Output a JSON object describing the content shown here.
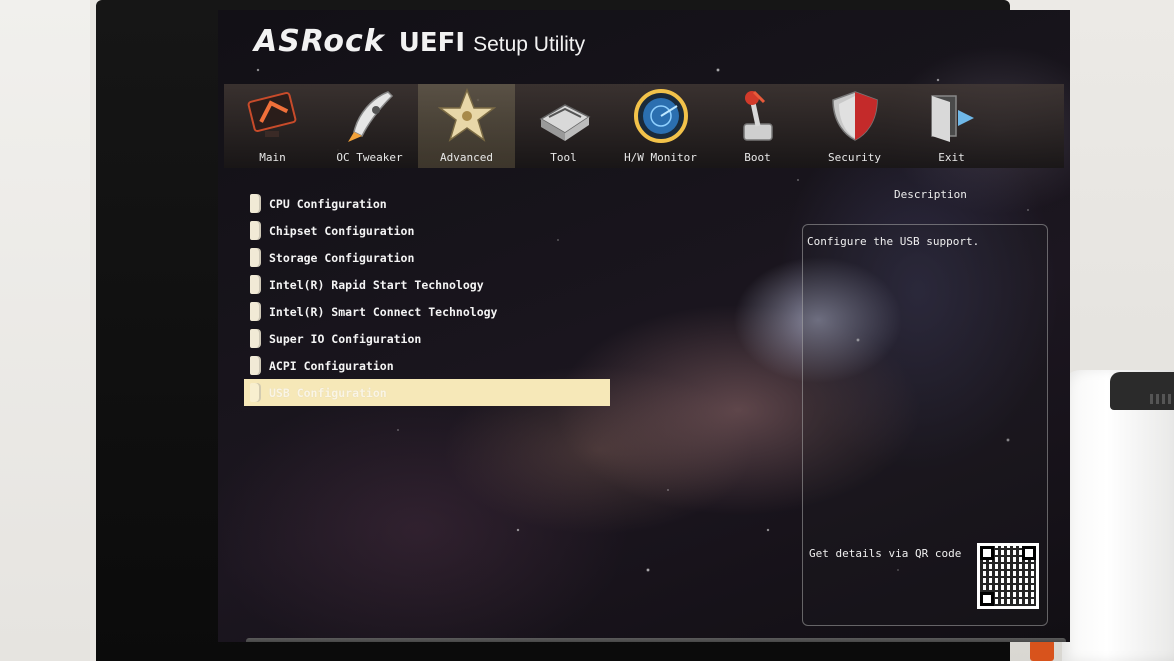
{
  "header": {
    "brand": "ASRock",
    "product": "UEFI",
    "subtitle": "Setup Utility"
  },
  "nav": {
    "active": "Advanced",
    "tabs": [
      {
        "label": "Main",
        "icon": "monitor-icon"
      },
      {
        "label": "OC Tweaker",
        "icon": "rocket-icon"
      },
      {
        "label": "Advanced",
        "icon": "star-icon"
      },
      {
        "label": "Tool",
        "icon": "toolbox-icon"
      },
      {
        "label": "H/W Monitor",
        "icon": "radar-icon"
      },
      {
        "label": "Boot",
        "icon": "joystick-icon"
      },
      {
        "label": "Security",
        "icon": "shield-icon"
      },
      {
        "label": "Exit",
        "icon": "exit-door-icon"
      }
    ]
  },
  "menu": {
    "selected_index": 7,
    "items": [
      {
        "label": "CPU Configuration"
      },
      {
        "label": "Chipset Configuration"
      },
      {
        "label": "Storage Configuration"
      },
      {
        "label": "Intel(R) Rapid Start Technology"
      },
      {
        "label": "Intel(R) Smart Connect Technology"
      },
      {
        "label": "Super IO Configuration"
      },
      {
        "label": "ACPI Configuration"
      },
      {
        "label": "USB Configuration"
      }
    ]
  },
  "description": {
    "title": "Description",
    "text": "Configure the USB support.",
    "qr_label": "Get details via QR code"
  },
  "colors": {
    "selection": "#f6e8b8",
    "text": "#f4f4f4"
  }
}
